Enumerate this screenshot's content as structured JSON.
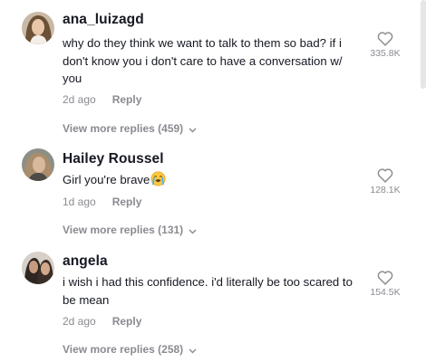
{
  "comments": [
    {
      "username": "ana_luizagd",
      "text": "why do they think we want to talk to them so bad? if i don't know you i don't care to have a conversation w/ you",
      "time": "2d ago",
      "reply_label": "Reply",
      "likes": "335.8K",
      "view_more": "View more replies (459)",
      "icon": "heart-outline-icon"
    },
    {
      "username": "Hailey Roussel",
      "text": "Girl you're brave",
      "emoji": "loudly-crying-face-icon",
      "time": "1d ago",
      "reply_label": "Reply",
      "likes": "128.1K",
      "view_more": "View more replies (131)",
      "icon": "heart-outline-icon"
    },
    {
      "username": "angela",
      "text": "i wish i had this confidence. i'd literally be too scared to be mean",
      "time": "2d ago",
      "reply_label": "Reply",
      "likes": "154.5K",
      "view_more": "View more replies (258)",
      "icon": "heart-outline-icon"
    }
  ],
  "colors": {
    "text": "#161823",
    "muted": "#8a8b91",
    "background": "#ffffff"
  }
}
